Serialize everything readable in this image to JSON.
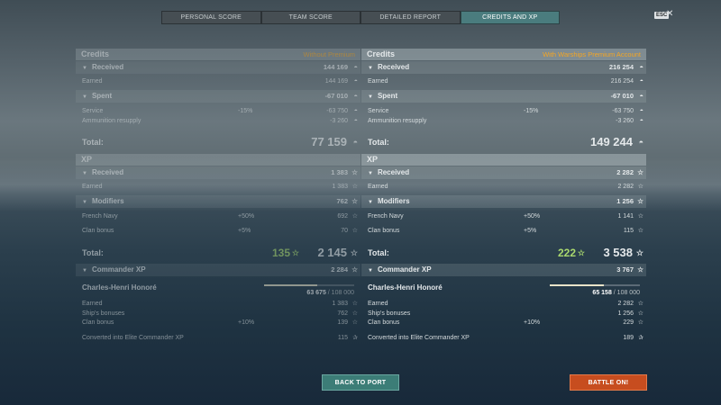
{
  "tabs": [
    {
      "label": "PERSONAL SCORE"
    },
    {
      "label": "TEAM SCORE"
    },
    {
      "label": "DETAILED REPORT"
    },
    {
      "label": "CREDITS AND XP"
    }
  ],
  "esc_label": "ESC",
  "columns": [
    {
      "credits_title": "Credits",
      "account_label": "Without Premium",
      "received_label": "Received",
      "received": "144 169",
      "earned_label": "Earned",
      "earned": "144 169",
      "spent_label": "Spent",
      "spent": "-67 010",
      "service_label": "Service",
      "service_pct": "-15%",
      "service": "-63 750",
      "ammo_label": "Ammunition resupply",
      "ammo": "-3 260",
      "total_label": "Total:",
      "total_credits": "77 159",
      "xp_title": "XP",
      "xp_received_label": "Received",
      "xp_received": "1 383",
      "xp_earned_label": "Earned",
      "xp_earned": "1 383",
      "modifiers_label": "Modifiers",
      "modifiers": "762",
      "navy_label": "French Navy",
      "navy_pct": "+50%",
      "navy": "692",
      "clan_label": "Clan bonus",
      "clan_pct": "+5%",
      "clan": "70",
      "xp_total_label": "Total:",
      "free_xp": "135",
      "xp_total": "2 145",
      "cmd_label": "Commander XP",
      "cmd_total": "2 284",
      "cmd_name": "Charles-Henri Honoré",
      "cmd_current": "63 675",
      "cmd_max": "/ 108 000",
      "cmd_progress": 0.59,
      "cmd_earned_label": "Earned",
      "cmd_earned": "1 383",
      "ship_bonus_label": "Ship's bonuses",
      "ship_bonus": "762",
      "cmd_clan_label": "Clan bonus",
      "cmd_clan_pct": "+10%",
      "cmd_clan": "139",
      "elite_label": "Converted into Elite Commander XP",
      "elite": "115"
    },
    {
      "credits_title": "Credits",
      "account_label": "With Warships Premium Account",
      "received_label": "Received",
      "received": "216 254",
      "earned_label": "Earned",
      "earned": "216 254",
      "spent_label": "Spent",
      "spent": "-67 010",
      "service_label": "Service",
      "service_pct": "-15%",
      "service": "-63 750",
      "ammo_label": "Ammunition resupply",
      "ammo": "-3 260",
      "total_label": "Total:",
      "total_credits": "149 244",
      "xp_title": "XP",
      "xp_received_label": "Received",
      "xp_received": "2 282",
      "xp_earned_label": "Earned",
      "xp_earned": "2 282",
      "modifiers_label": "Modifiers",
      "modifiers": "1 256",
      "navy_label": "French Navy",
      "navy_pct": "+50%",
      "navy": "1 141",
      "clan_label": "Clan bonus",
      "clan_pct": "+5%",
      "clan": "115",
      "xp_total_label": "Total:",
      "free_xp": "222",
      "xp_total": "3 538",
      "cmd_label": "Commander XP",
      "cmd_total": "3 767",
      "cmd_name": "Charles-Henri Honoré",
      "cmd_current": "65 158",
      "cmd_max": "/ 108 000",
      "cmd_progress": 0.603,
      "cmd_earned_label": "Earned",
      "cmd_earned": "2 282",
      "ship_bonus_label": "Ship's bonuses",
      "ship_bonus": "1 256",
      "cmd_clan_label": "Clan bonus",
      "cmd_clan_pct": "+10%",
      "cmd_clan": "229",
      "elite_label": "Converted into Elite Commander XP",
      "elite": "189"
    }
  ],
  "buttons": {
    "back": "BACK TO PORT",
    "battle": "BATTLE ON!"
  },
  "colors": {
    "accent_tab": "#4a7c7e",
    "premium_label": "#f5a623",
    "free_xp": "#a9d86e",
    "back_button": "#3c7d77",
    "battle_button": "#c74d1f"
  },
  "icons": {
    "credits": "coin-icon",
    "xp": "star-icon",
    "free_xp": "free-xp-star-icon",
    "elite": "elite-xp-icon"
  }
}
